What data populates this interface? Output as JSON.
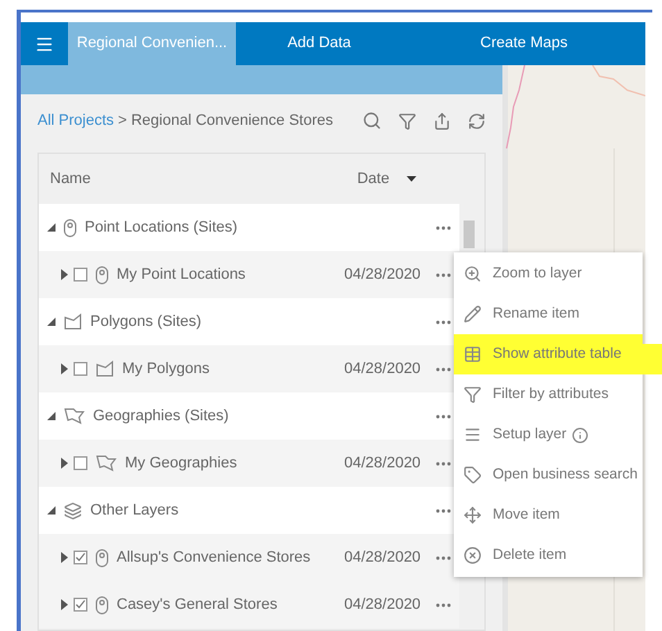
{
  "header": {
    "tabs": [
      {
        "label": "Regional Convenien...",
        "selected": true
      },
      {
        "label": "Add Data",
        "selected": false
      },
      {
        "label": "Create Maps",
        "selected": false
      }
    ]
  },
  "breadcrumb": {
    "link": "All Projects",
    "separator": ">",
    "current": "Regional Convenience Stores"
  },
  "table": {
    "columns": [
      "Name",
      "Date"
    ],
    "groups": [
      {
        "name": "Point Locations (Sites)",
        "kind": "point",
        "expanded": true,
        "children": [
          {
            "name": "My Point Locations",
            "kind": "point",
            "date": "04/28/2020",
            "checked": false,
            "expanded": false
          }
        ]
      },
      {
        "name": "Polygons (Sites)",
        "kind": "polygon",
        "expanded": true,
        "children": [
          {
            "name": "My Polygons",
            "kind": "polygon",
            "date": "04/28/2020",
            "checked": false,
            "expanded": false
          }
        ]
      },
      {
        "name": "Geographies (Sites)",
        "kind": "geography",
        "expanded": true,
        "children": [
          {
            "name": "My Geographies",
            "kind": "geography",
            "date": "04/28/2020",
            "checked": false,
            "expanded": false
          }
        ]
      },
      {
        "name": "Other Layers",
        "kind": "layers",
        "expanded": true,
        "children": [
          {
            "name": "Allsup's Convenience Stores",
            "kind": "point",
            "date": "04/28/2020",
            "checked": true,
            "expanded": false
          },
          {
            "name": "Casey's General Stores",
            "kind": "point",
            "date": "04/28/2020",
            "checked": true,
            "expanded": false
          }
        ]
      }
    ]
  },
  "context_menu": {
    "items": [
      {
        "label": "Zoom to layer",
        "kind": "zoom",
        "highlighted": false
      },
      {
        "label": "Rename item",
        "kind": "rename",
        "highlighted": false
      },
      {
        "label": "Show attribute table",
        "kind": "table",
        "highlighted": true
      },
      {
        "label": "Filter by attributes",
        "kind": "filter",
        "highlighted": false
      },
      {
        "label": "Setup layer",
        "kind": "setup",
        "highlighted": false
      },
      {
        "label": "Open business search",
        "kind": "business",
        "highlighted": false
      },
      {
        "label": "Move item",
        "kind": "move",
        "highlighted": false
      },
      {
        "label": "Delete item",
        "kind": "delete",
        "highlighted": false
      }
    ]
  }
}
